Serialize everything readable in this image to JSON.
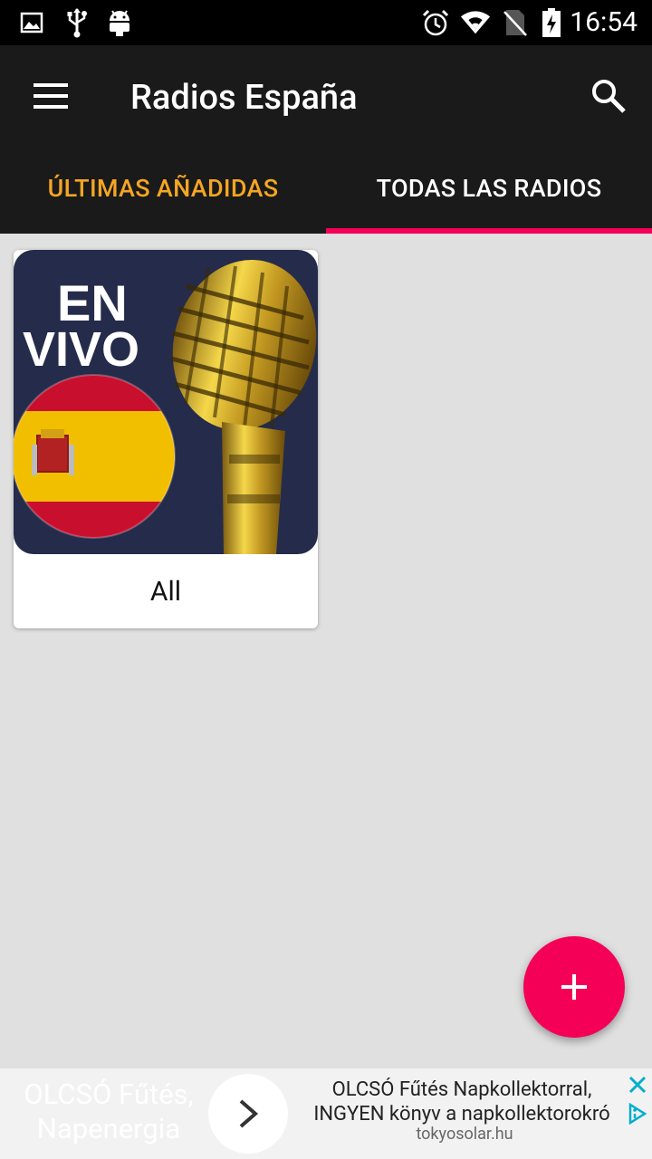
{
  "status_bar": {
    "time": "16:54",
    "icons": [
      "image-icon",
      "usb-icon",
      "android-icon",
      "alarm-icon",
      "wifi-icon",
      "no-sim-icon",
      "battery-charging-icon"
    ]
  },
  "app_bar": {
    "title": "Radios España",
    "menu_icon": "hamburger-menu-icon",
    "search_icon": "search-icon"
  },
  "tabs": [
    {
      "label": "ÚLTIMAS AÑADIDAS",
      "selected": false,
      "color": "#f5a623"
    },
    {
      "label": "TODAS LAS RADIOS",
      "selected": true,
      "color": "#ffffff"
    }
  ],
  "cards": [
    {
      "image_text_line1": "EN",
      "image_text_line2": "VIVO",
      "label": "All"
    }
  ],
  "fab": {
    "icon": "plus-icon",
    "color": "#f50057"
  },
  "ad": {
    "left_text": "OLCSÓ Fűtés, Napenergia",
    "headline": "OLCSÓ Fűtés Napkollektorral, INGYEN könyv a napkollektorokró",
    "domain": "tokyosolar.hu",
    "arrow_icon": "chevron-right-icon",
    "close_icon": "close-icon",
    "adchoices_icon": "adchoices-icon"
  },
  "colors": {
    "accent": "#f50057",
    "tab_unselected": "#f5a623",
    "appbar": "#1a1a1a",
    "background": "#e0e0e0"
  }
}
